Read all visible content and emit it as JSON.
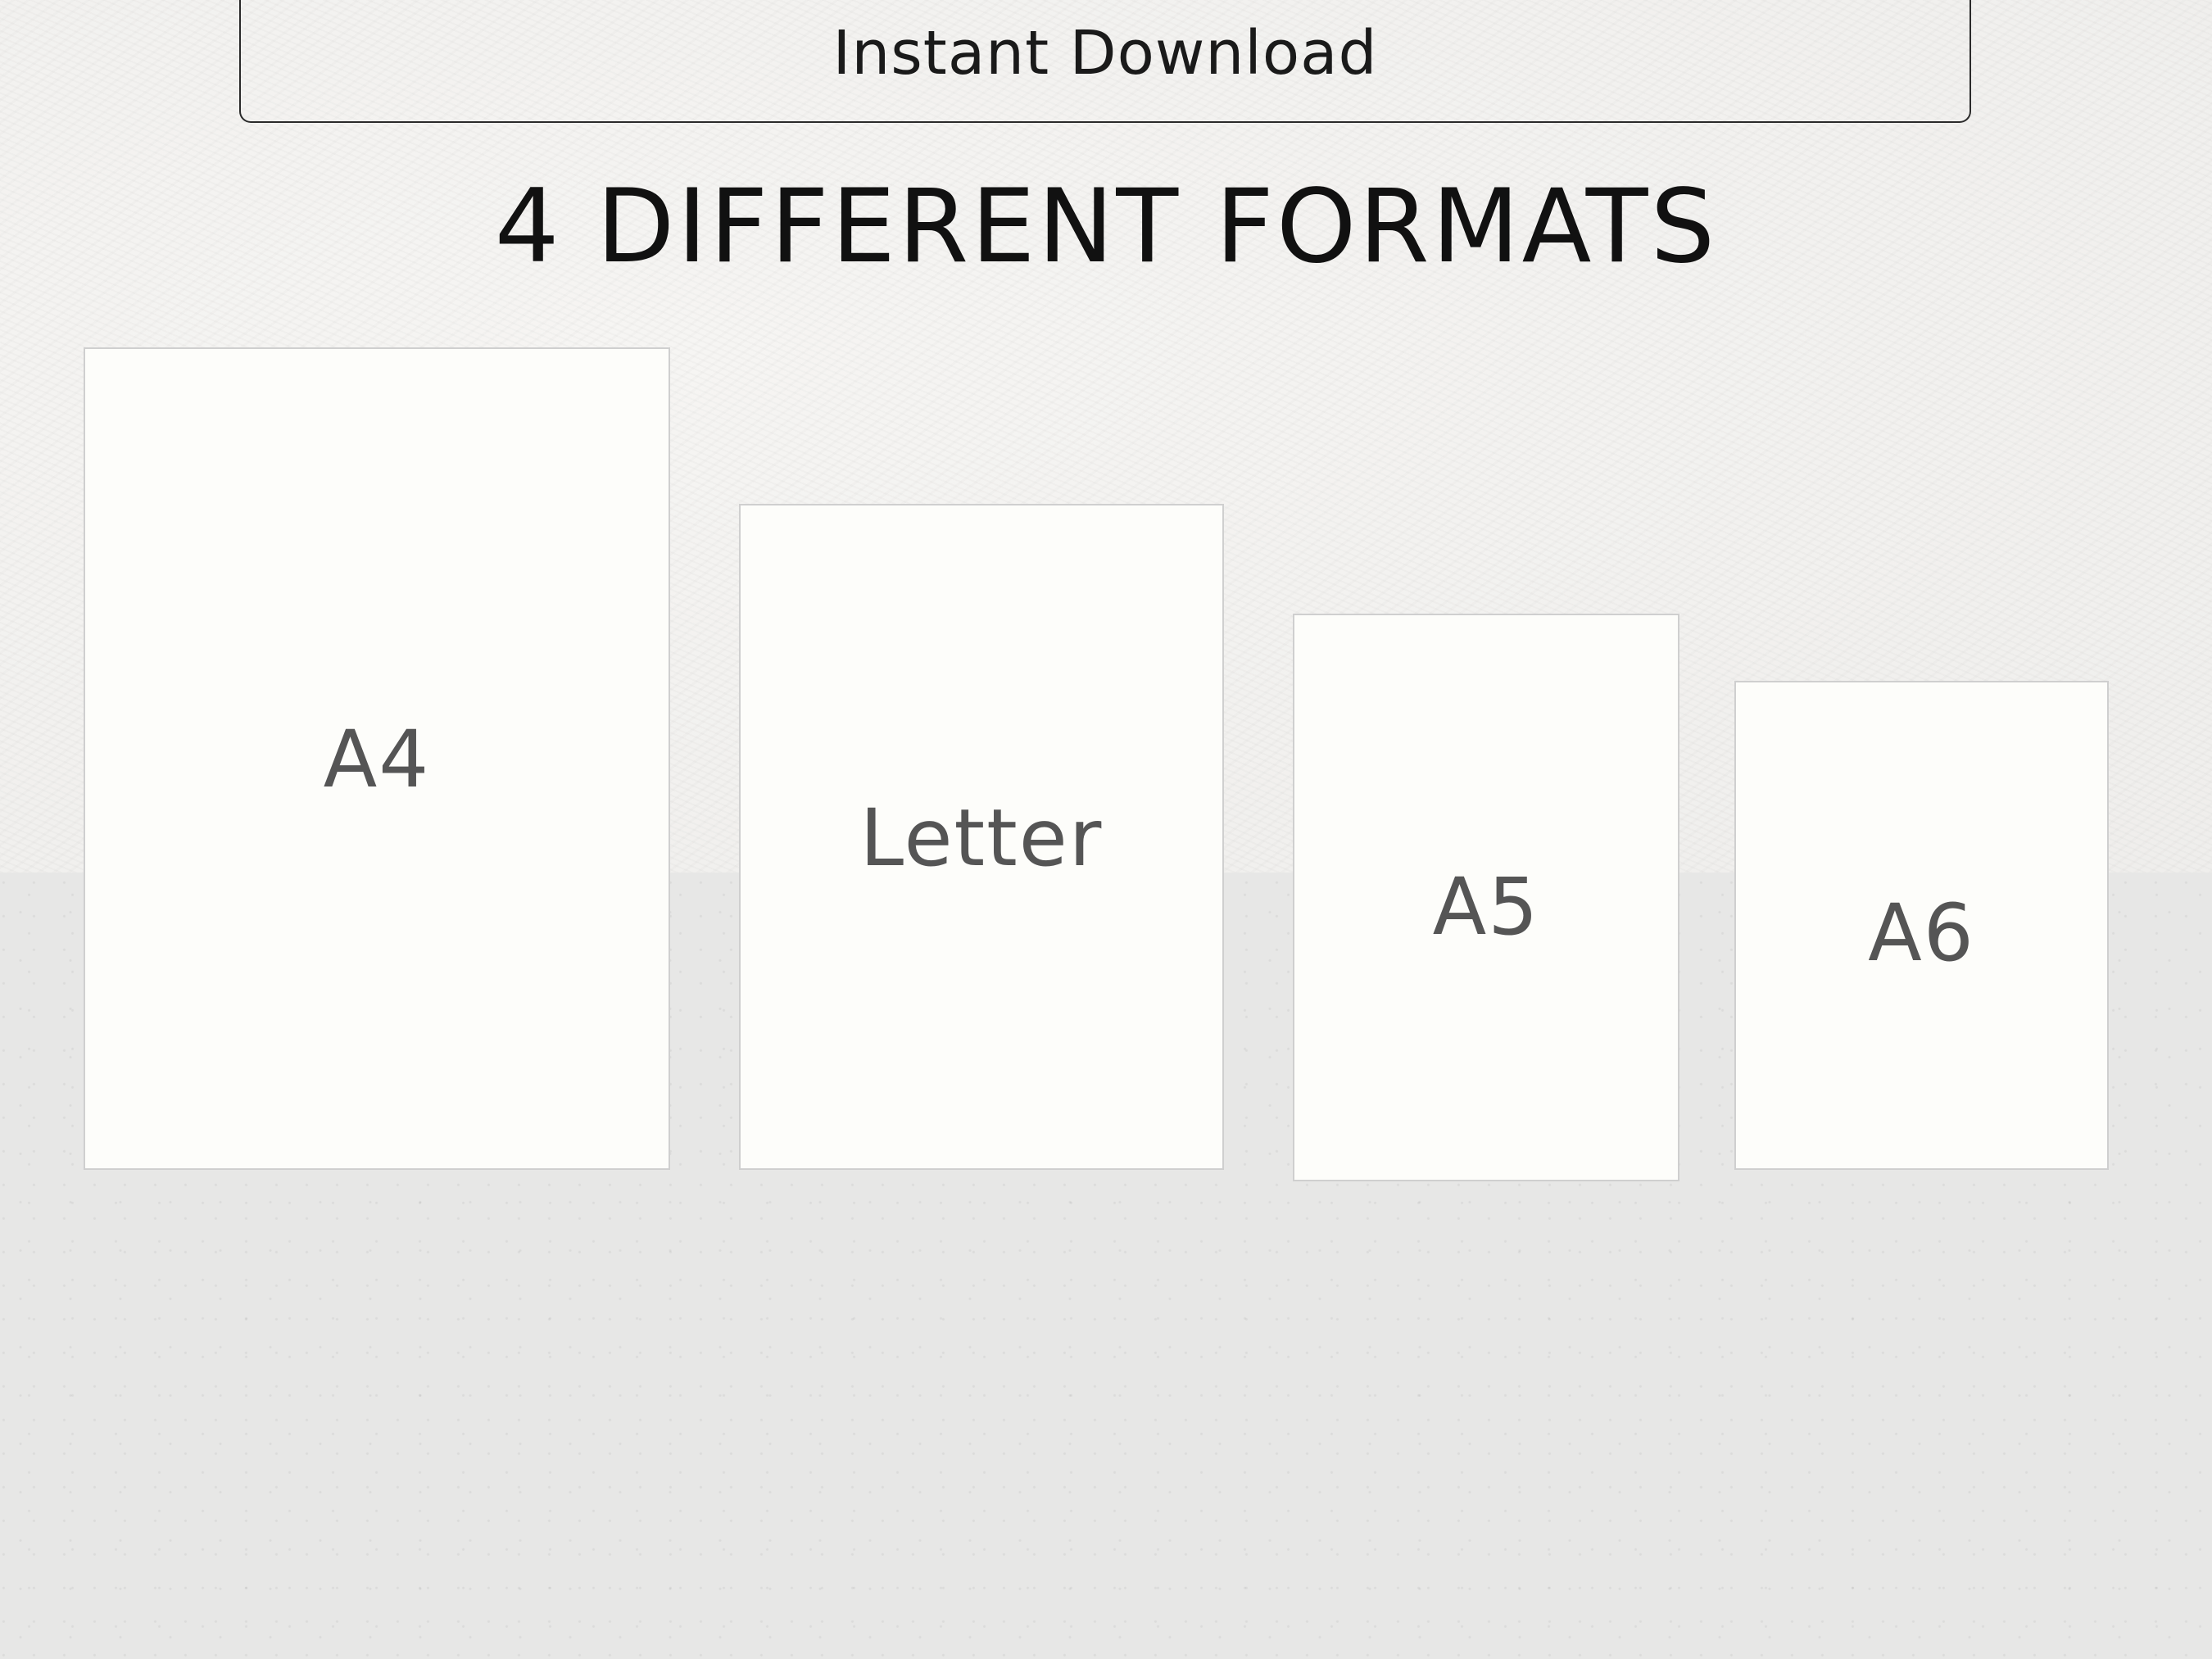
{
  "header": {
    "download_label": "Instant Download",
    "headline": "4 DIFFERENT FORMATS"
  },
  "formats": [
    {
      "label": "A4"
    },
    {
      "label": "Letter"
    },
    {
      "label": "A5"
    },
    {
      "label": "A6"
    }
  ],
  "colors": {
    "label_gray": "#555555",
    "card_fill": "#fdfdfa",
    "card_border": "#cfcfcf"
  }
}
